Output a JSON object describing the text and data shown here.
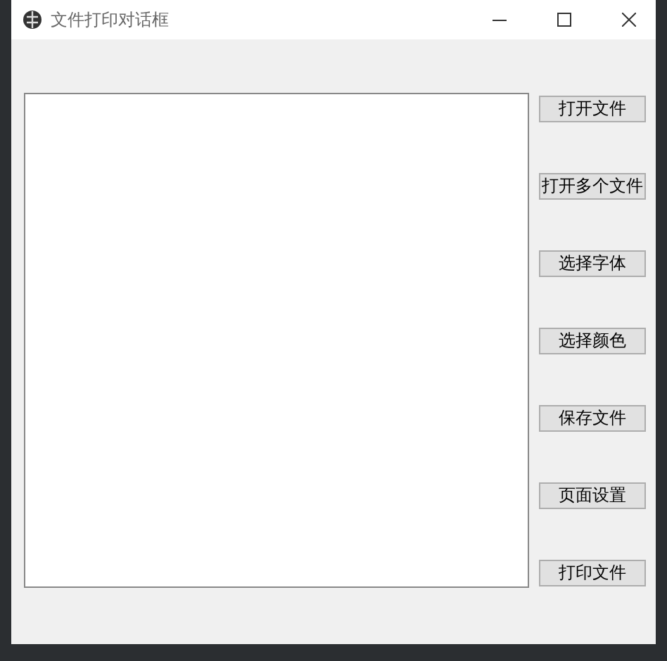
{
  "window": {
    "title": "文件打印对话框"
  },
  "buttons": [
    "打开文件",
    "打开多个文件",
    "选择字体",
    "选择颜色",
    "保存文件",
    "页面设置",
    "打印文件"
  ]
}
